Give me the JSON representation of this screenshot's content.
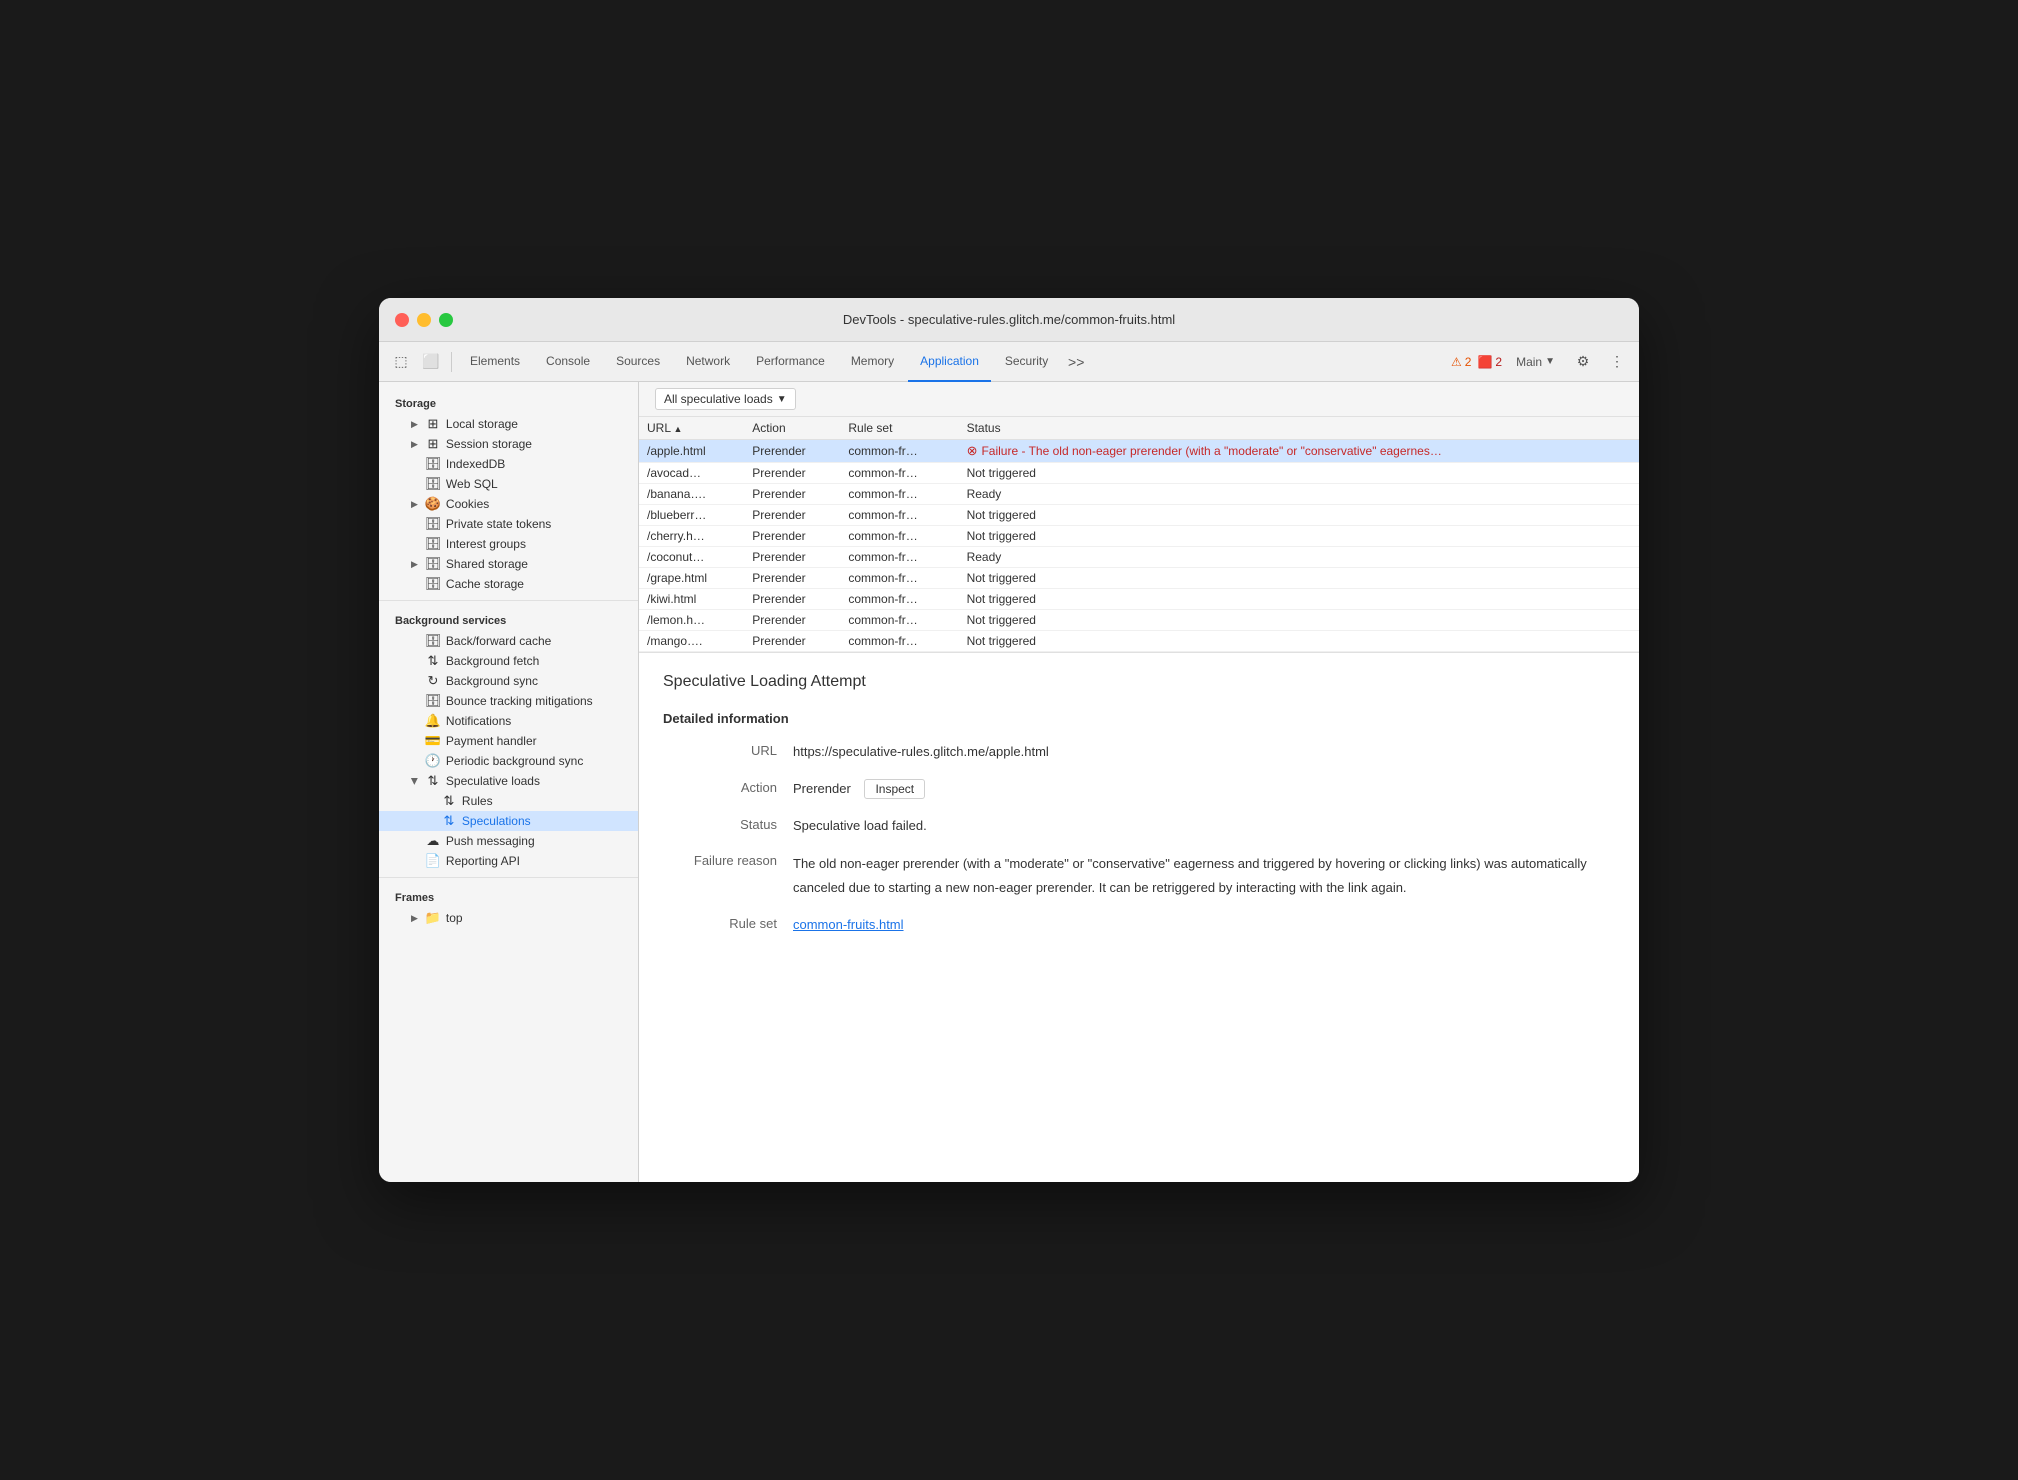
{
  "titlebar": {
    "title": "DevTools - speculative-rules.glitch.me/common-fruits.html"
  },
  "toolbar": {
    "tabs": [
      {
        "label": "Elements",
        "active": false
      },
      {
        "label": "Console",
        "active": false
      },
      {
        "label": "Sources",
        "active": false
      },
      {
        "label": "Network",
        "active": false
      },
      {
        "label": "Performance",
        "active": false
      },
      {
        "label": "Memory",
        "active": false
      },
      {
        "label": "Application",
        "active": true
      },
      {
        "label": "Security",
        "active": false
      }
    ],
    "warnings": "2",
    "errors": "2",
    "main_label": "Main",
    "more_label": ">>"
  },
  "sidebar": {
    "storage_header": "Storage",
    "background_header": "Background services",
    "frames_header": "Frames",
    "items": [
      {
        "id": "local-storage",
        "label": "Local storage",
        "icon": "grid",
        "indent": 1,
        "hasChevron": true,
        "chevronOpen": false
      },
      {
        "id": "session-storage",
        "label": "Session storage",
        "icon": "grid",
        "indent": 1,
        "hasChevron": true,
        "chevronOpen": false
      },
      {
        "id": "indexed-db",
        "label": "IndexedDB",
        "icon": "cylinder",
        "indent": 1,
        "hasChevron": false
      },
      {
        "id": "web-sql",
        "label": "Web SQL",
        "icon": "cylinder",
        "indent": 1,
        "hasChevron": false
      },
      {
        "id": "cookies",
        "label": "Cookies",
        "icon": "cookie",
        "indent": 1,
        "hasChevron": true,
        "chevronOpen": false
      },
      {
        "id": "private-state",
        "label": "Private state tokens",
        "icon": "cylinder",
        "indent": 1,
        "hasChevron": false
      },
      {
        "id": "interest-groups",
        "label": "Interest groups",
        "icon": "cylinder",
        "indent": 1,
        "hasChevron": false
      },
      {
        "id": "shared-storage",
        "label": "Shared storage",
        "icon": "cylinder",
        "indent": 1,
        "hasChevron": true,
        "chevronOpen": false
      },
      {
        "id": "cache-storage",
        "label": "Cache storage",
        "icon": "cylinder",
        "indent": 1,
        "hasChevron": false
      },
      {
        "id": "back-forward",
        "label": "Back/forward cache",
        "icon": "cylinder",
        "indent": 1,
        "hasChevron": false
      },
      {
        "id": "background-fetch",
        "label": "Background fetch",
        "icon": "arrow-up-down",
        "indent": 1,
        "hasChevron": false
      },
      {
        "id": "background-sync",
        "label": "Background sync",
        "icon": "refresh",
        "indent": 1,
        "hasChevron": false
      },
      {
        "id": "bounce-tracking",
        "label": "Bounce tracking mitigations",
        "icon": "cylinder",
        "indent": 1,
        "hasChevron": false
      },
      {
        "id": "notifications",
        "label": "Notifications",
        "icon": "bell",
        "indent": 1,
        "hasChevron": false
      },
      {
        "id": "payment-handler",
        "label": "Payment handler",
        "icon": "card",
        "indent": 1,
        "hasChevron": false
      },
      {
        "id": "periodic-sync",
        "label": "Periodic background sync",
        "icon": "clock",
        "indent": 1,
        "hasChevron": false
      },
      {
        "id": "speculative-loads",
        "label": "Speculative loads",
        "icon": "arrow-up-down",
        "indent": 1,
        "hasChevron": true,
        "chevronOpen": true
      },
      {
        "id": "rules",
        "label": "Rules",
        "icon": "arrow-up-down",
        "indent": 2,
        "hasChevron": false
      },
      {
        "id": "speculations",
        "label": "Speculations",
        "icon": "arrow-up-down",
        "indent": 2,
        "hasChevron": false,
        "active": true
      },
      {
        "id": "push-messaging",
        "label": "Push messaging",
        "icon": "cloud",
        "indent": 1,
        "hasChevron": false
      },
      {
        "id": "reporting-api",
        "label": "Reporting API",
        "icon": "doc",
        "indent": 1,
        "hasChevron": false
      },
      {
        "id": "top",
        "label": "top",
        "icon": "folder",
        "indent": 1,
        "hasChevron": true,
        "chevronOpen": false
      }
    ]
  },
  "content": {
    "filter_label": "All speculative loads",
    "table": {
      "columns": [
        "URL",
        "Action",
        "Rule set",
        "Status"
      ],
      "rows": [
        {
          "url": "/apple.html",
          "action": "Prerender",
          "ruleset": "common-fr…",
          "status": "error",
          "status_text": "Failure - The old non-eager prerender (with a \"moderate\" or \"conservative\" eagernes…",
          "selected": true
        },
        {
          "url": "/avocad…",
          "action": "Prerender",
          "ruleset": "common-fr…",
          "status": "text",
          "status_text": "Not triggered",
          "selected": false
        },
        {
          "url": "/banana….",
          "action": "Prerender",
          "ruleset": "common-fr…",
          "status": "text",
          "status_text": "Ready",
          "selected": false
        },
        {
          "url": "/blueberr…",
          "action": "Prerender",
          "ruleset": "common-fr…",
          "status": "text",
          "status_text": "Not triggered",
          "selected": false
        },
        {
          "url": "/cherry.h…",
          "action": "Prerender",
          "ruleset": "common-fr…",
          "status": "text",
          "status_text": "Not triggered",
          "selected": false
        },
        {
          "url": "/coconut…",
          "action": "Prerender",
          "ruleset": "common-fr…",
          "status": "text",
          "status_text": "Ready",
          "selected": false
        },
        {
          "url": "/grape.html",
          "action": "Prerender",
          "ruleset": "common-fr…",
          "status": "text",
          "status_text": "Not triggered",
          "selected": false
        },
        {
          "url": "/kiwi.html",
          "action": "Prerender",
          "ruleset": "common-fr…",
          "status": "text",
          "status_text": "Not triggered",
          "selected": false
        },
        {
          "url": "/lemon.h…",
          "action": "Prerender",
          "ruleset": "common-fr…",
          "status": "text",
          "status_text": "Not triggered",
          "selected": false
        },
        {
          "url": "/mango….",
          "action": "Prerender",
          "ruleset": "common-fr…",
          "status": "text",
          "status_text": "Not triggered",
          "selected": false
        }
      ]
    },
    "detail": {
      "title": "Speculative Loading Attempt",
      "section_header": "Detailed information",
      "url_label": "URL",
      "url_value": "https://speculative-rules.glitch.me/apple.html",
      "action_label": "Action",
      "action_value": "Prerender",
      "inspect_label": "Inspect",
      "status_label": "Status",
      "status_value": "Speculative load failed.",
      "failure_label": "Failure reason",
      "failure_text": "The old non-eager prerender (with a \"moderate\" or \"conservative\" eagerness and triggered by hovering or clicking links) was automatically canceled due to starting a new non-eager prerender. It can be retriggered by interacting with the link again.",
      "ruleset_label": "Rule set",
      "ruleset_link": "common-fruits.html"
    }
  }
}
